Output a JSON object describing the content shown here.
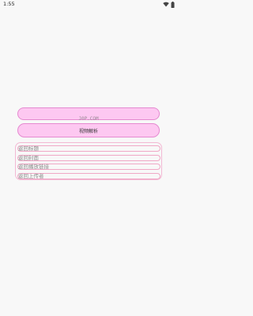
{
  "status_bar": {
    "time": "1:55",
    "icons": [
      "wifi-icon",
      "battery-icon"
    ]
  },
  "url_input": {
    "value": "J0P.COM"
  },
  "parse_button": {
    "label": "视频解析"
  },
  "results": [
    {
      "label": "返回标题"
    },
    {
      "label": "返回封面"
    },
    {
      "label": "返回播放链接"
    },
    {
      "label": "返回上传者"
    }
  ],
  "colors": {
    "accent_fill": "#fdc8f1",
    "accent_border": "#e58ad0",
    "result_border": "#f0a8c6",
    "background": "#f8f8f8"
  }
}
